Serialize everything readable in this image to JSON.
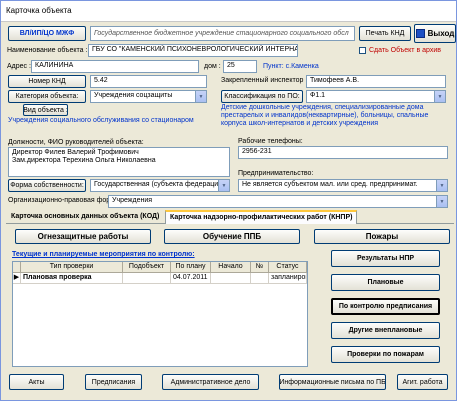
{
  "window": {
    "title": "Карточка объекта"
  },
  "header": {
    "tag_label": "ВЛ/ИП/ЦО МЖФ",
    "org_full_name": "Государственное бюджетное учреждение стационарного социального обсл",
    "print_label": "Печать КНД",
    "exit_label": "Выход"
  },
  "object": {
    "name_label": "Наименование объекта :",
    "name_value": "ГБУ СО \"КАМЕНСКИЙ ПСИХОНЕВРОЛОГИЧЕСКИЙ ИНТЕРНАТ\"",
    "archive_label": "Сдать Объект в архив",
    "address_label": "Адрес :",
    "address_value": "КАЛИНИНА",
    "house_label": "дом :",
    "house_value": "25",
    "place_value": "Пункт: с.Каменка",
    "knd_label": "Номер КНД",
    "knd_value": "5.42",
    "inspector_label": "Закрепленный инспектор",
    "inspector_value": "Тимофеев А.В.",
    "category_label": "Категория объекта:",
    "category_value": "Учреждения соцзащиты",
    "class_label": "Классификация по ПО:",
    "class_value": "Ф1.1",
    "type_label": "Вид объекта :",
    "class_description": "Детские дошкольные учреждения, специализированные дома престарелых и инвалидов(неквартирные), больницы, спальные корпуса школ-интернатов и детских учреждения",
    "type_value": "Учреждения социального обслуживания со стационаром",
    "heads_label": "Должности, ФИО руководителей объекта:",
    "heads_line1": "Директор Филев Валерий Трофимович",
    "heads_line2": "Зам.директора Терехина Ольга Николаевна",
    "phones_label": "Рабочие телефоны:",
    "phones_value": "2956-231",
    "business_label": "Предпринимательство:",
    "business_value": "Не является субъектом мал. или сред. предпринимат.",
    "ownership_label": "Форма собственности:",
    "ownership_value": "Государственная (субъекта федерации)",
    "legal_form_label": "Организационно-правовая форма:",
    "legal_form_value": "Учреждения"
  },
  "tabs": [
    {
      "label": "Карточка основных данных объекта  (КОД)"
    },
    {
      "label": "Карточка надзорно-профилактических работ  (КНПР)"
    }
  ],
  "work_buttons": {
    "fire": "Огнезащитные работы",
    "ppb": "Обучение ППБ",
    "fires": "Пожары"
  },
  "events": {
    "title": "Текущие и планируемые мероприятия по контролю:",
    "columns": [
      "Тип проверки",
      "Подобъект",
      "По плану",
      "Начало",
      "№",
      "Статус"
    ],
    "rows": [
      {
        "type": "Плановая проверка",
        "subobject": "",
        "planned": "04.07.2011",
        "start": "",
        "number": "",
        "status": "запланирована"
      }
    ]
  },
  "side_buttons": {
    "npr_results": "Результаты НПР",
    "planned": "Плановые",
    "by_order": "По контролю предписания",
    "other_unplanned": "Другие внеплановые",
    "fire_checks": "Проверки по пожарам"
  },
  "bottom_buttons": {
    "acts": "Акты",
    "orders": "Предписания",
    "admin_case": "Административное дело",
    "info_letters": "Информационные письма по ПБ",
    "agit": "Агит. работа"
  }
}
